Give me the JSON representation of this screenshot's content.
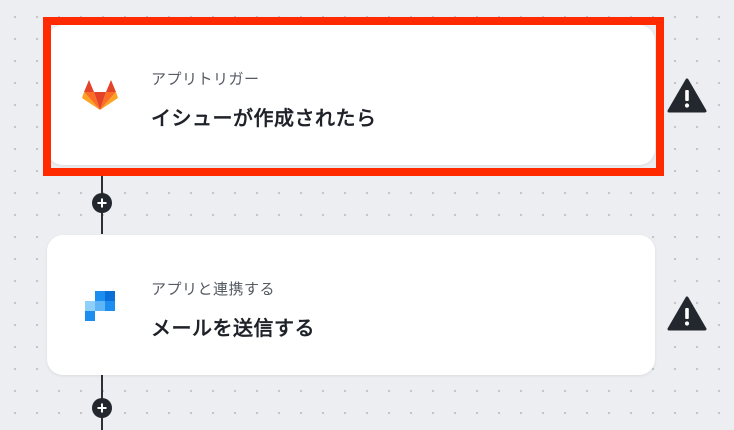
{
  "steps": [
    {
      "label": "アプリトリガー",
      "title": "イシューが作成されたら",
      "icon": "gitlab-logo-icon",
      "highlighted": true,
      "highlight_color": "#ff2a00",
      "warning_icon": "warning-triangle-icon"
    },
    {
      "label": "アプリと連携する",
      "title": "メールを送信する",
      "icon": "mail-app-logo-icon",
      "highlighted": false,
      "warning_icon": "warning-triangle-icon"
    }
  ],
  "add_step_icon": "plus-icon",
  "colors": {
    "canvas_background": "#eceef1",
    "card_background": "#ffffff",
    "connector": "#2b2f36",
    "warning": "#23272e"
  }
}
